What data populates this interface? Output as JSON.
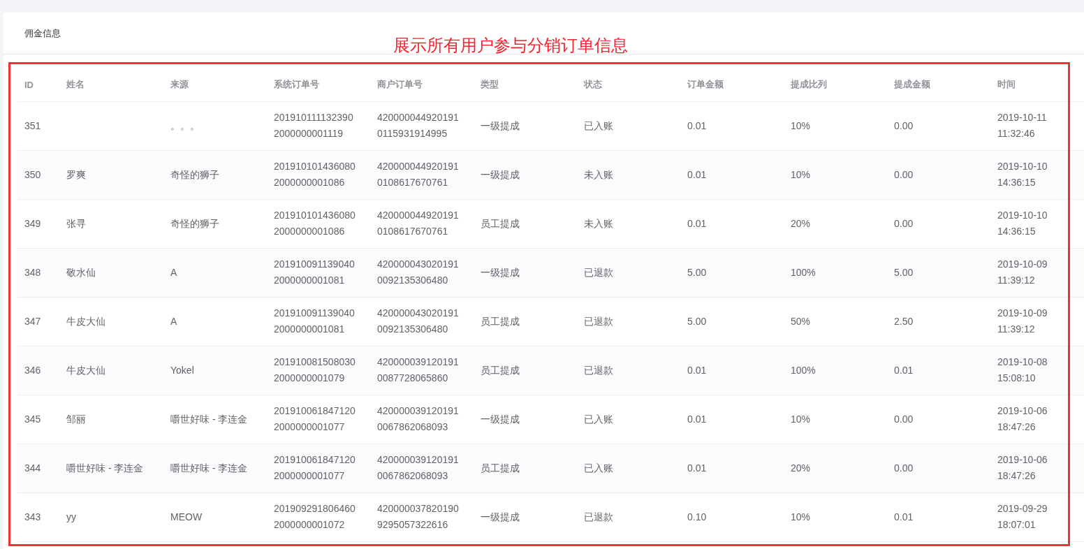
{
  "panel": {
    "title": "佣金信息"
  },
  "annotation": {
    "text": "展示所有用户参与分销订单信息"
  },
  "table": {
    "columns": [
      "ID",
      "姓名",
      "来源",
      "系统订单号",
      "商户订单号",
      "类型",
      "状态",
      "订单金额",
      "提成比列",
      "提成金额",
      "时间"
    ],
    "rows": [
      {
        "id": "351",
        "source": "。。。",
        "system_order_no": "2019101111323902000000001119",
        "merchant_order_no": "4200000449201910115931914995",
        "type": "一级提成",
        "status": "已入账",
        "order_amount": "0.01",
        "commission_rate": "10%",
        "commission_amount": "0.00",
        "time": "2019-10-11 11:32:46"
      },
      {
        "id": "350",
        "name": "罗爽",
        "source": "奇怪的狮子",
        "system_order_no": "2019101014360802000000001086",
        "merchant_order_no": "4200000449201910108617670761",
        "type": "一级提成",
        "status": "未入账",
        "order_amount": "0.01",
        "commission_rate": "10%",
        "commission_amount": "0.00",
        "time": "2019-10-10 14:36:15"
      },
      {
        "id": "349",
        "name": "张寻",
        "source": "奇怪的狮子",
        "system_order_no": "2019101014360802000000001086",
        "merchant_order_no": "4200000449201910108617670761",
        "type": "员工提成",
        "status": "未入账",
        "order_amount": "0.01",
        "commission_rate": "20%",
        "commission_amount": "0.00",
        "time": "2019-10-10 14:36:15"
      },
      {
        "id": "348",
        "name": "敬水仙",
        "source": "A",
        "system_order_no": "2019100911390402000000001081",
        "merchant_order_no": "4200000430201910092135306480",
        "type": "一级提成",
        "status": "已退款",
        "order_amount": "5.00",
        "commission_rate": "100%",
        "commission_amount": "5.00",
        "time": "2019-10-09 11:39:12"
      },
      {
        "id": "347",
        "name": "牛皮大仙",
        "source": "A",
        "system_order_no": "2019100911390402000000001081",
        "merchant_order_no": "4200000430201910092135306480",
        "type": "员工提成",
        "status": "已退款",
        "order_amount": "5.00",
        "commission_rate": "50%",
        "commission_amount": "2.50",
        "time": "2019-10-09 11:39:12"
      },
      {
        "id": "346",
        "name": "牛皮大仙",
        "source": "Yokel",
        "system_order_no": "2019100815080302000000001079",
        "merchant_order_no": "4200000391201910087728065860",
        "type": "员工提成",
        "status": "已退款",
        "order_amount": "0.01",
        "commission_rate": "100%",
        "commission_amount": "0.01",
        "time": "2019-10-08 15:08:10"
      },
      {
        "id": "345",
        "name": "邹丽",
        "source": "嚼世好味 - 李连金",
        "system_order_no": "2019100618471202000000001077",
        "merchant_order_no": "4200000391201910067862068093",
        "type": "一级提成",
        "status": "已入账",
        "order_amount": "0.01",
        "commission_rate": "10%",
        "commission_amount": "0.00",
        "time": "2019-10-06 18:47:26"
      },
      {
        "id": "344",
        "name": "嚼世好味 - 李连金",
        "source": "嚼世好味 - 李连金",
        "system_order_no": "2019100618471202000000001077",
        "merchant_order_no": "4200000391201910067862068093",
        "type": "员工提成",
        "status": "已入账",
        "order_amount": "0.01",
        "commission_rate": "20%",
        "commission_amount": "0.00",
        "time": "2019-10-06 18:47:26"
      },
      {
        "id": "343",
        "name": "yy",
        "source": "MEOW",
        "system_order_no": "2019092918064602000000001072",
        "merchant_order_no": "4200000378201909295057322616",
        "type": "一级提成",
        "status": "已退款",
        "order_amount": "0.10",
        "commission_rate": "10%",
        "commission_amount": "0.01",
        "time": "2019-09-29 18:07:01"
      }
    ]
  }
}
